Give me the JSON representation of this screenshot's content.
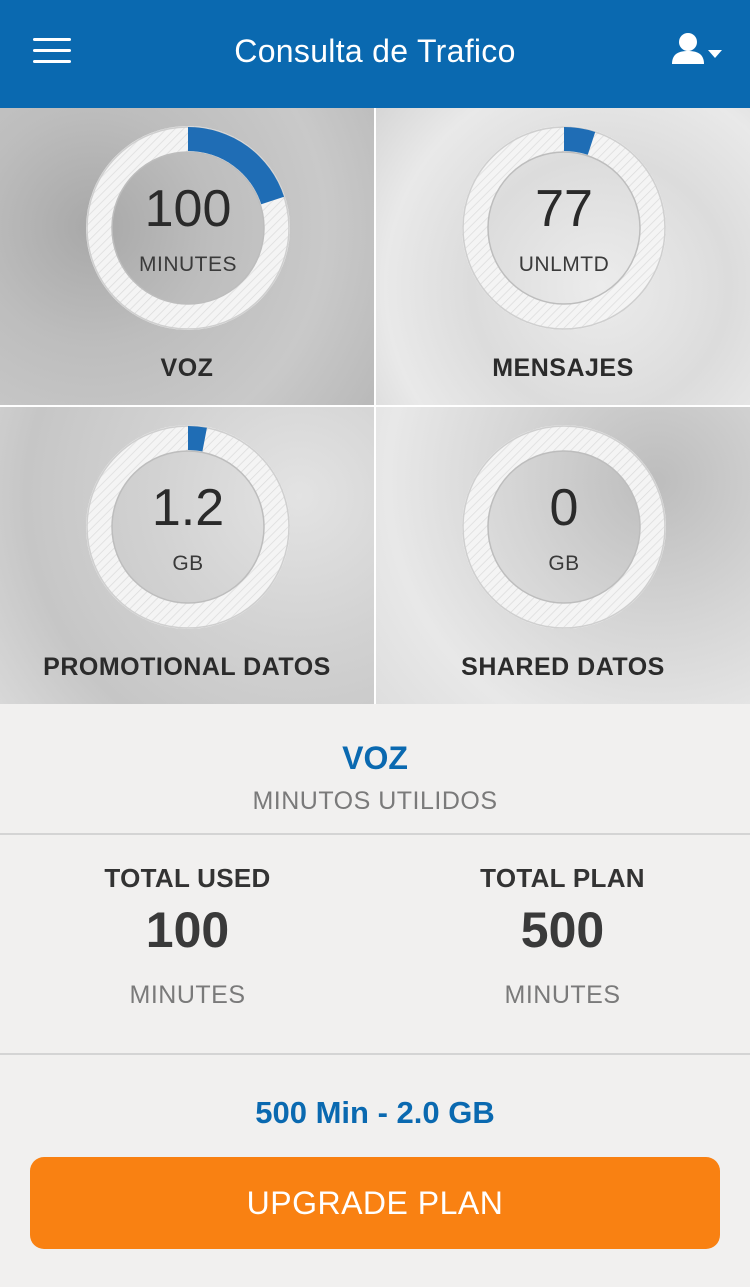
{
  "header": {
    "title": "Consulta de Trafico",
    "menu_icon": "hamburger-menu-icon",
    "user_icon": "user-dropdown-icon"
  },
  "tiles": [
    {
      "label": "VOZ",
      "value": "100",
      "unit": "MINUTES",
      "usage_fraction": 0.2
    },
    {
      "label": "MENSAJES",
      "value": "77",
      "unit": "UNLMTD",
      "usage_fraction": 0.05
    },
    {
      "label": "PROMOTIONAL DATOS",
      "value": "1.2",
      "unit": "GB",
      "usage_fraction": 0.03
    },
    {
      "label": "SHARED DATOS",
      "value": "0",
      "unit": "GB",
      "usage_fraction": 0
    }
  ],
  "detail": {
    "title": "VOZ",
    "subtitle": "MINUTOS UTILIDOS",
    "used": {
      "label": "TOTAL USED",
      "value": "100",
      "unit": "MINUTES"
    },
    "plan": {
      "label": "TOTAL PLAN",
      "value": "500",
      "unit": "MINUTES"
    }
  },
  "plan_name": "500 Min - 2.0 GB",
  "upgrade_label": "UPGRADE PLAN",
  "colors": {
    "brand_blue": "#0a69b0",
    "accent_orange": "#f98112",
    "ring_track": "#f2f2f2",
    "ring_fill": "#1f6db5"
  }
}
